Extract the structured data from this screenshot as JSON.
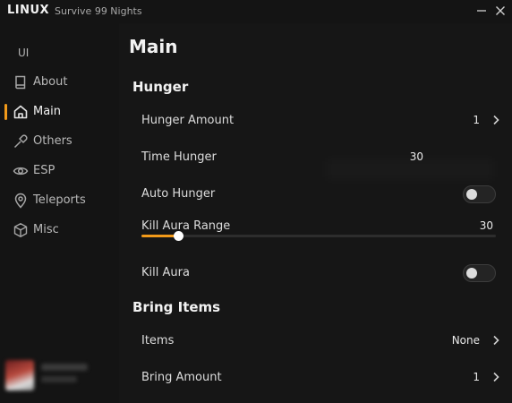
{
  "window": {
    "brand": "LINUX",
    "subtitle": "Survive 99 Nights"
  },
  "sidebar": {
    "section_label": "UI",
    "active_accent": "#f29a1a",
    "items": [
      {
        "label": "About",
        "icon": "book-icon",
        "active": false
      },
      {
        "label": "Main",
        "icon": "home-icon",
        "active": true
      },
      {
        "label": "Others",
        "icon": "tools-icon",
        "active": false
      },
      {
        "label": "ESP",
        "icon": "eye-icon",
        "active": false
      },
      {
        "label": "Teleports",
        "icon": "map-pin-icon",
        "active": false
      },
      {
        "label": "Misc",
        "icon": "cube-icon",
        "active": false
      }
    ]
  },
  "main": {
    "title": "Main",
    "sections": [
      {
        "title": "Hunger",
        "rows": [
          {
            "type": "dropdown",
            "label": "Hunger Amount",
            "value": "1"
          },
          {
            "type": "input",
            "label": "Time Hunger",
            "value": "30"
          },
          {
            "type": "toggle",
            "label": "Auto Hunger",
            "on": false
          },
          {
            "type": "slider",
            "label": "Kill Aura Range",
            "value": "30",
            "fraction": 0.1
          },
          {
            "type": "toggle",
            "label": "Kill Aura",
            "on": false
          }
        ]
      },
      {
        "title": "Bring Items",
        "rows": [
          {
            "type": "dropdown",
            "label": "Items",
            "value": "None"
          },
          {
            "type": "dropdown",
            "label": "Bring Amount",
            "value": "1"
          }
        ]
      }
    ]
  }
}
